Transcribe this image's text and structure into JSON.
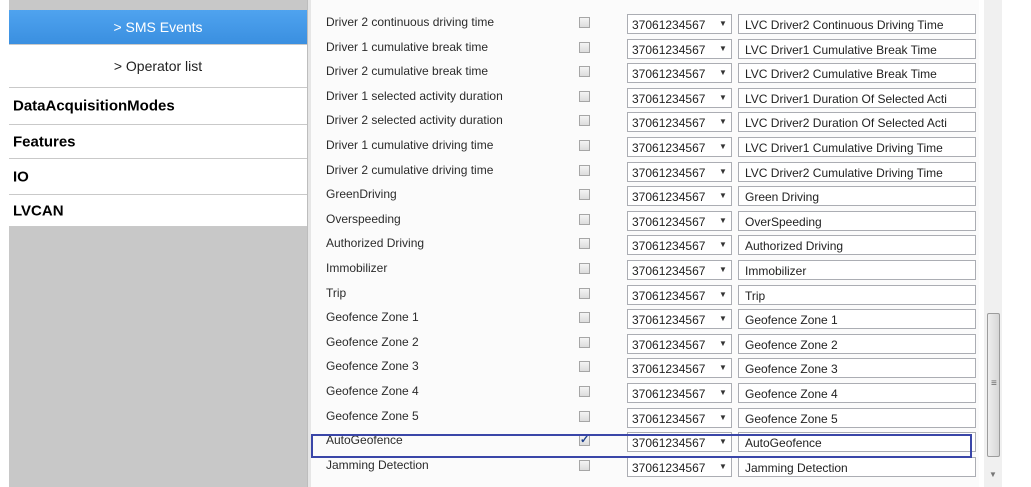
{
  "nav": {
    "items": [
      {
        "label": "> SMS Events",
        "kind": "sub",
        "selected": true
      },
      {
        "label": "> Operator list",
        "kind": "sub",
        "selected": false
      },
      {
        "label": "DataAcquisitionModes",
        "kind": "top",
        "selected": false
      },
      {
        "label": "Features",
        "kind": "top",
        "selected": false
      },
      {
        "label": "IO",
        "kind": "top",
        "selected": false
      },
      {
        "label": "LVCAN",
        "kind": "top",
        "selected": false
      }
    ]
  },
  "table": {
    "rows": [
      {
        "label": "Driver 2 continuous driving time",
        "checked": false,
        "number": "37061234567",
        "text": "LVC Driver2 Continuous Driving Time"
      },
      {
        "label": "Driver 1 cumulative break time",
        "checked": false,
        "number": "37061234567",
        "text": "LVC Driver1 Cumulative Break Time"
      },
      {
        "label": "Driver 2 cumulative break time",
        "checked": false,
        "number": "37061234567",
        "text": "LVC Driver2 Cumulative Break Time"
      },
      {
        "label": "Driver 1 selected activity duration",
        "checked": false,
        "number": "37061234567",
        "text": "LVC Driver1 Duration Of Selected Acti"
      },
      {
        "label": "Driver 2 selected activity duration",
        "checked": false,
        "number": "37061234567",
        "text": "LVC Driver2 Duration Of Selected Acti"
      },
      {
        "label": "Driver 1 cumulative driving time",
        "checked": false,
        "number": "37061234567",
        "text": "LVC Driver1 Cumulative Driving Time"
      },
      {
        "label": "Driver 2 cumulative driving time",
        "checked": false,
        "number": "37061234567",
        "text": "LVC Driver2 Cumulative Driving Time"
      },
      {
        "label": "GreenDriving",
        "checked": false,
        "number": "37061234567",
        "text": "Green Driving"
      },
      {
        "label": "Overspeeding",
        "checked": false,
        "number": "37061234567",
        "text": "OverSpeeding"
      },
      {
        "label": "Authorized Driving",
        "checked": false,
        "number": "37061234567",
        "text": "Authorized Driving"
      },
      {
        "label": "Immobilizer",
        "checked": false,
        "number": "37061234567",
        "text": "Immobilizer"
      },
      {
        "label": "Trip",
        "checked": false,
        "number": "37061234567",
        "text": "Trip"
      },
      {
        "label": "Geofence Zone 1",
        "checked": false,
        "number": "37061234567",
        "text": "Geofence Zone 1"
      },
      {
        "label": "Geofence Zone 2",
        "checked": false,
        "number": "37061234567",
        "text": "Geofence Zone 2"
      },
      {
        "label": "Geofence Zone 3",
        "checked": false,
        "number": "37061234567",
        "text": "Geofence Zone 3"
      },
      {
        "label": "Geofence Zone 4",
        "checked": false,
        "number": "37061234567",
        "text": "Geofence Zone 4"
      },
      {
        "label": "Geofence Zone 5",
        "checked": false,
        "number": "37061234567",
        "text": "Geofence Zone 5"
      },
      {
        "label": "AutoGeofence",
        "checked": true,
        "number": "37061234567",
        "text": "AutoGeofence"
      },
      {
        "label": "Jamming Detection",
        "checked": false,
        "number": "37061234567",
        "text": "Jamming Detection"
      }
    ]
  },
  "colors": {
    "selected_nav": "#3a8fe0",
    "highlight_border": "#3a46a8",
    "nav_background": "#c8c8c8"
  },
  "icons": {
    "dropdown": "chevron-down-icon",
    "scroll_grip": "grip-icon",
    "scroll_down": "scroll-down-arrow-icon"
  }
}
